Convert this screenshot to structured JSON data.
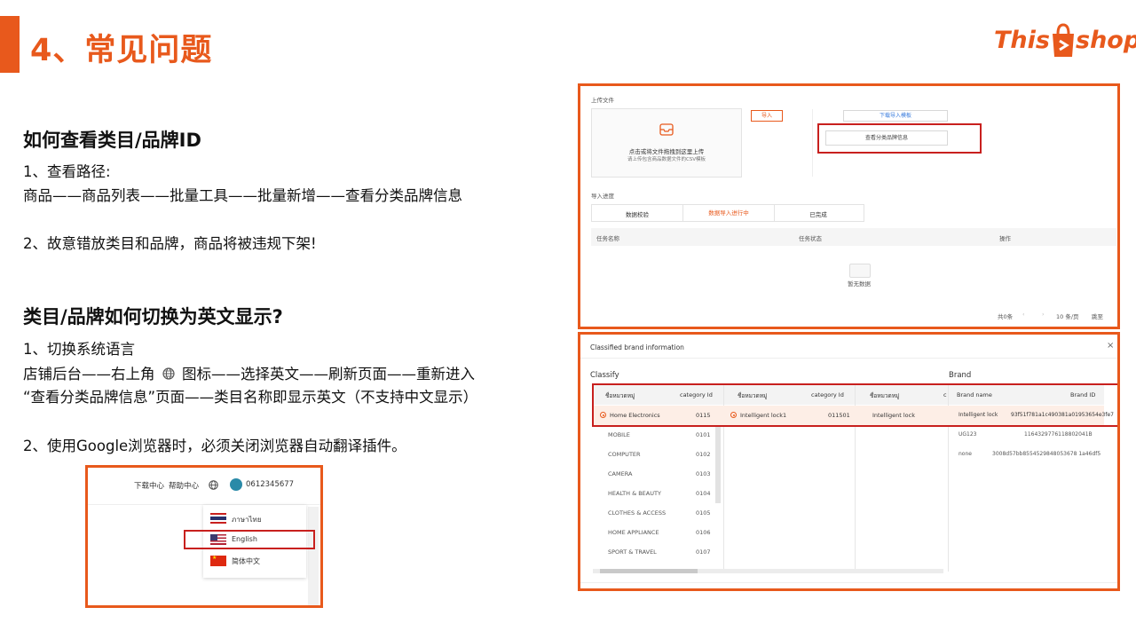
{
  "slide": {
    "title": "4、常见问题",
    "logo": {
      "left": "This",
      "right": "shop"
    }
  },
  "faq1": {
    "heading": "如何查看类目/品牌ID",
    "step1_label": "1、查看路径:",
    "step1_path": "商品——商品列表——批量工具——批量新增——查看分类品牌信息",
    "step2": "2、故意错放类目和品牌，商品将被违规下架!"
  },
  "faq2": {
    "heading": "类目/品牌如何切换为英文显示?",
    "step1_label": "1、切换系统语言",
    "step1_line1_a": "店铺后台——右上角",
    "step1_line1_b": "图标——选择英文——刷新页面——重新进入",
    "step1_line2": "“查看分类品牌信息”页面——类目名称即显示英文（不支持中文显示）",
    "step2": "2、使用Google浏览器时，必须关闭浏览器自动翻译插件。"
  },
  "lang_shot": {
    "download_center": "下载中心",
    "help_center": "帮助中心",
    "phone": "0612345677",
    "options": [
      {
        "label": "ภาษาไทย",
        "flag": "th"
      },
      {
        "label": "English",
        "flag": "us"
      },
      {
        "label": "简体中文",
        "flag": "cn"
      }
    ]
  },
  "upload_shot": {
    "section_upload": "上传文件",
    "drop_line1": "点击或将文件拖拽到这里上传",
    "drop_line2": "请上传包含商品数据文件的CSV模板",
    "import_button": "导入",
    "download_template": "下载导入模板",
    "view_brand_info": "查看分类品牌信息",
    "section_progress": "导入进度",
    "tabs": [
      "数据校验",
      "数据导入进行中",
      "已完成"
    ],
    "columns": [
      "任务名称",
      "任务状态",
      "操作"
    ],
    "empty": "暂无数据",
    "pagination": {
      "total": "共0条",
      "per_page": "10 条/页",
      "goto": "跳至"
    }
  },
  "brand_shot": {
    "dialog_title": "Classified brand information",
    "close": "×",
    "classify_label": "Classify",
    "brand_label": "Brand",
    "col_name": "ชื่อหมวดหมู่",
    "col_id": "category Id",
    "col3_trunc": "c",
    "brand_name_col": "Brand name",
    "brand_id_col": "Brand ID",
    "level1": [
      {
        "name": "Home Electronics",
        "id": "0115",
        "selected": true
      },
      {
        "name": "MOBILE",
        "id": "0101"
      },
      {
        "name": "COMPUTER",
        "id": "0102"
      },
      {
        "name": "CAMERA",
        "id": "0103"
      },
      {
        "name": "HEALTH & BEAUTY",
        "id": "0104"
      },
      {
        "name": "CLOTHES & ACCESS",
        "id": "0105"
      },
      {
        "name": "HOME APPLIANCE",
        "id": "0106"
      },
      {
        "name": "SPORT & TRAVEL",
        "id": "0107"
      }
    ],
    "level2": {
      "name": "Intelligent lock1",
      "id": "011501"
    },
    "level3": {
      "name": "Intelligent lock"
    },
    "brands": [
      {
        "name": "Intelligent lock",
        "id": "93f51f781a1c490381a01953654e3fe7"
      },
      {
        "name": "UG123",
        "id": "1164329776118802041B"
      },
      {
        "name": "none",
        "id": "3008d57bb8554529848053678 1a46df5"
      }
    ]
  },
  "colors": {
    "accent": "#e8591c",
    "highlight": "#c8201e"
  }
}
